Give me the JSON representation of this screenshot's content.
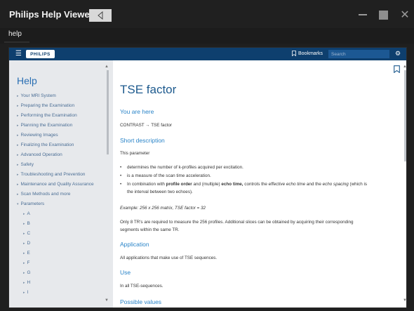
{
  "window": {
    "title": "Philips Help Viewer"
  },
  "tab": {
    "label": "help"
  },
  "topnav": {
    "logo": "PHILIPS",
    "bookmarks_label": "Bookmarks",
    "search_placeholder": "Search"
  },
  "sidebar": {
    "heading": "Help",
    "items": [
      "Your MRI System",
      "Preparing the Examination",
      "Performing the Examination",
      "Planning the Examination",
      "Reviewing Images",
      "Finalizing the Examination",
      "Advanced Operation",
      "Safety",
      "Troubleshooting and Prevention",
      "Maintenance and Quality Assurance",
      "Scan Methods and more",
      "Parameters"
    ],
    "sub_items": [
      "A",
      "B",
      "C",
      "D",
      "E",
      "F",
      "G",
      "H",
      "I"
    ]
  },
  "content": {
    "title": "TSE factor",
    "you_are_here_heading": "You are here",
    "breadcrumb": "CONTRAST → TSE factor",
    "short_desc_heading": "Short description",
    "short_desc_intro": "This parameter",
    "bullets": {
      "b1": "determines the number of k-profiles acquired per excitation.",
      "b2": "is a measure of the scan time acceleration.",
      "b3_a": "In combination with ",
      "b3_b": "profile order",
      "b3_c": " and (multiple) ",
      "b3_d": "echo time,",
      "b3_e": " controls the ",
      "b3_f": "effective echo time",
      "b3_g": " and the ",
      "b3_h": "echo spacing",
      "b3_i": " (which is",
      "b3_cont": "the interval between two echoes)."
    },
    "example": "Example: 256 x 256 matrix, TSE factor = 32",
    "para1_line1": "Only 8 TR's are required to measure the 256 profiles. Additional slices can be obtained by acquiring their corresponding",
    "para1_line2": "segments within the same TR.",
    "application_heading": "Application",
    "application_text": "All applications that make use of TSE sequences.",
    "use_heading": "Use",
    "use_text": "In all TSE-sequences.",
    "possible_values_heading": "Possible values"
  }
}
